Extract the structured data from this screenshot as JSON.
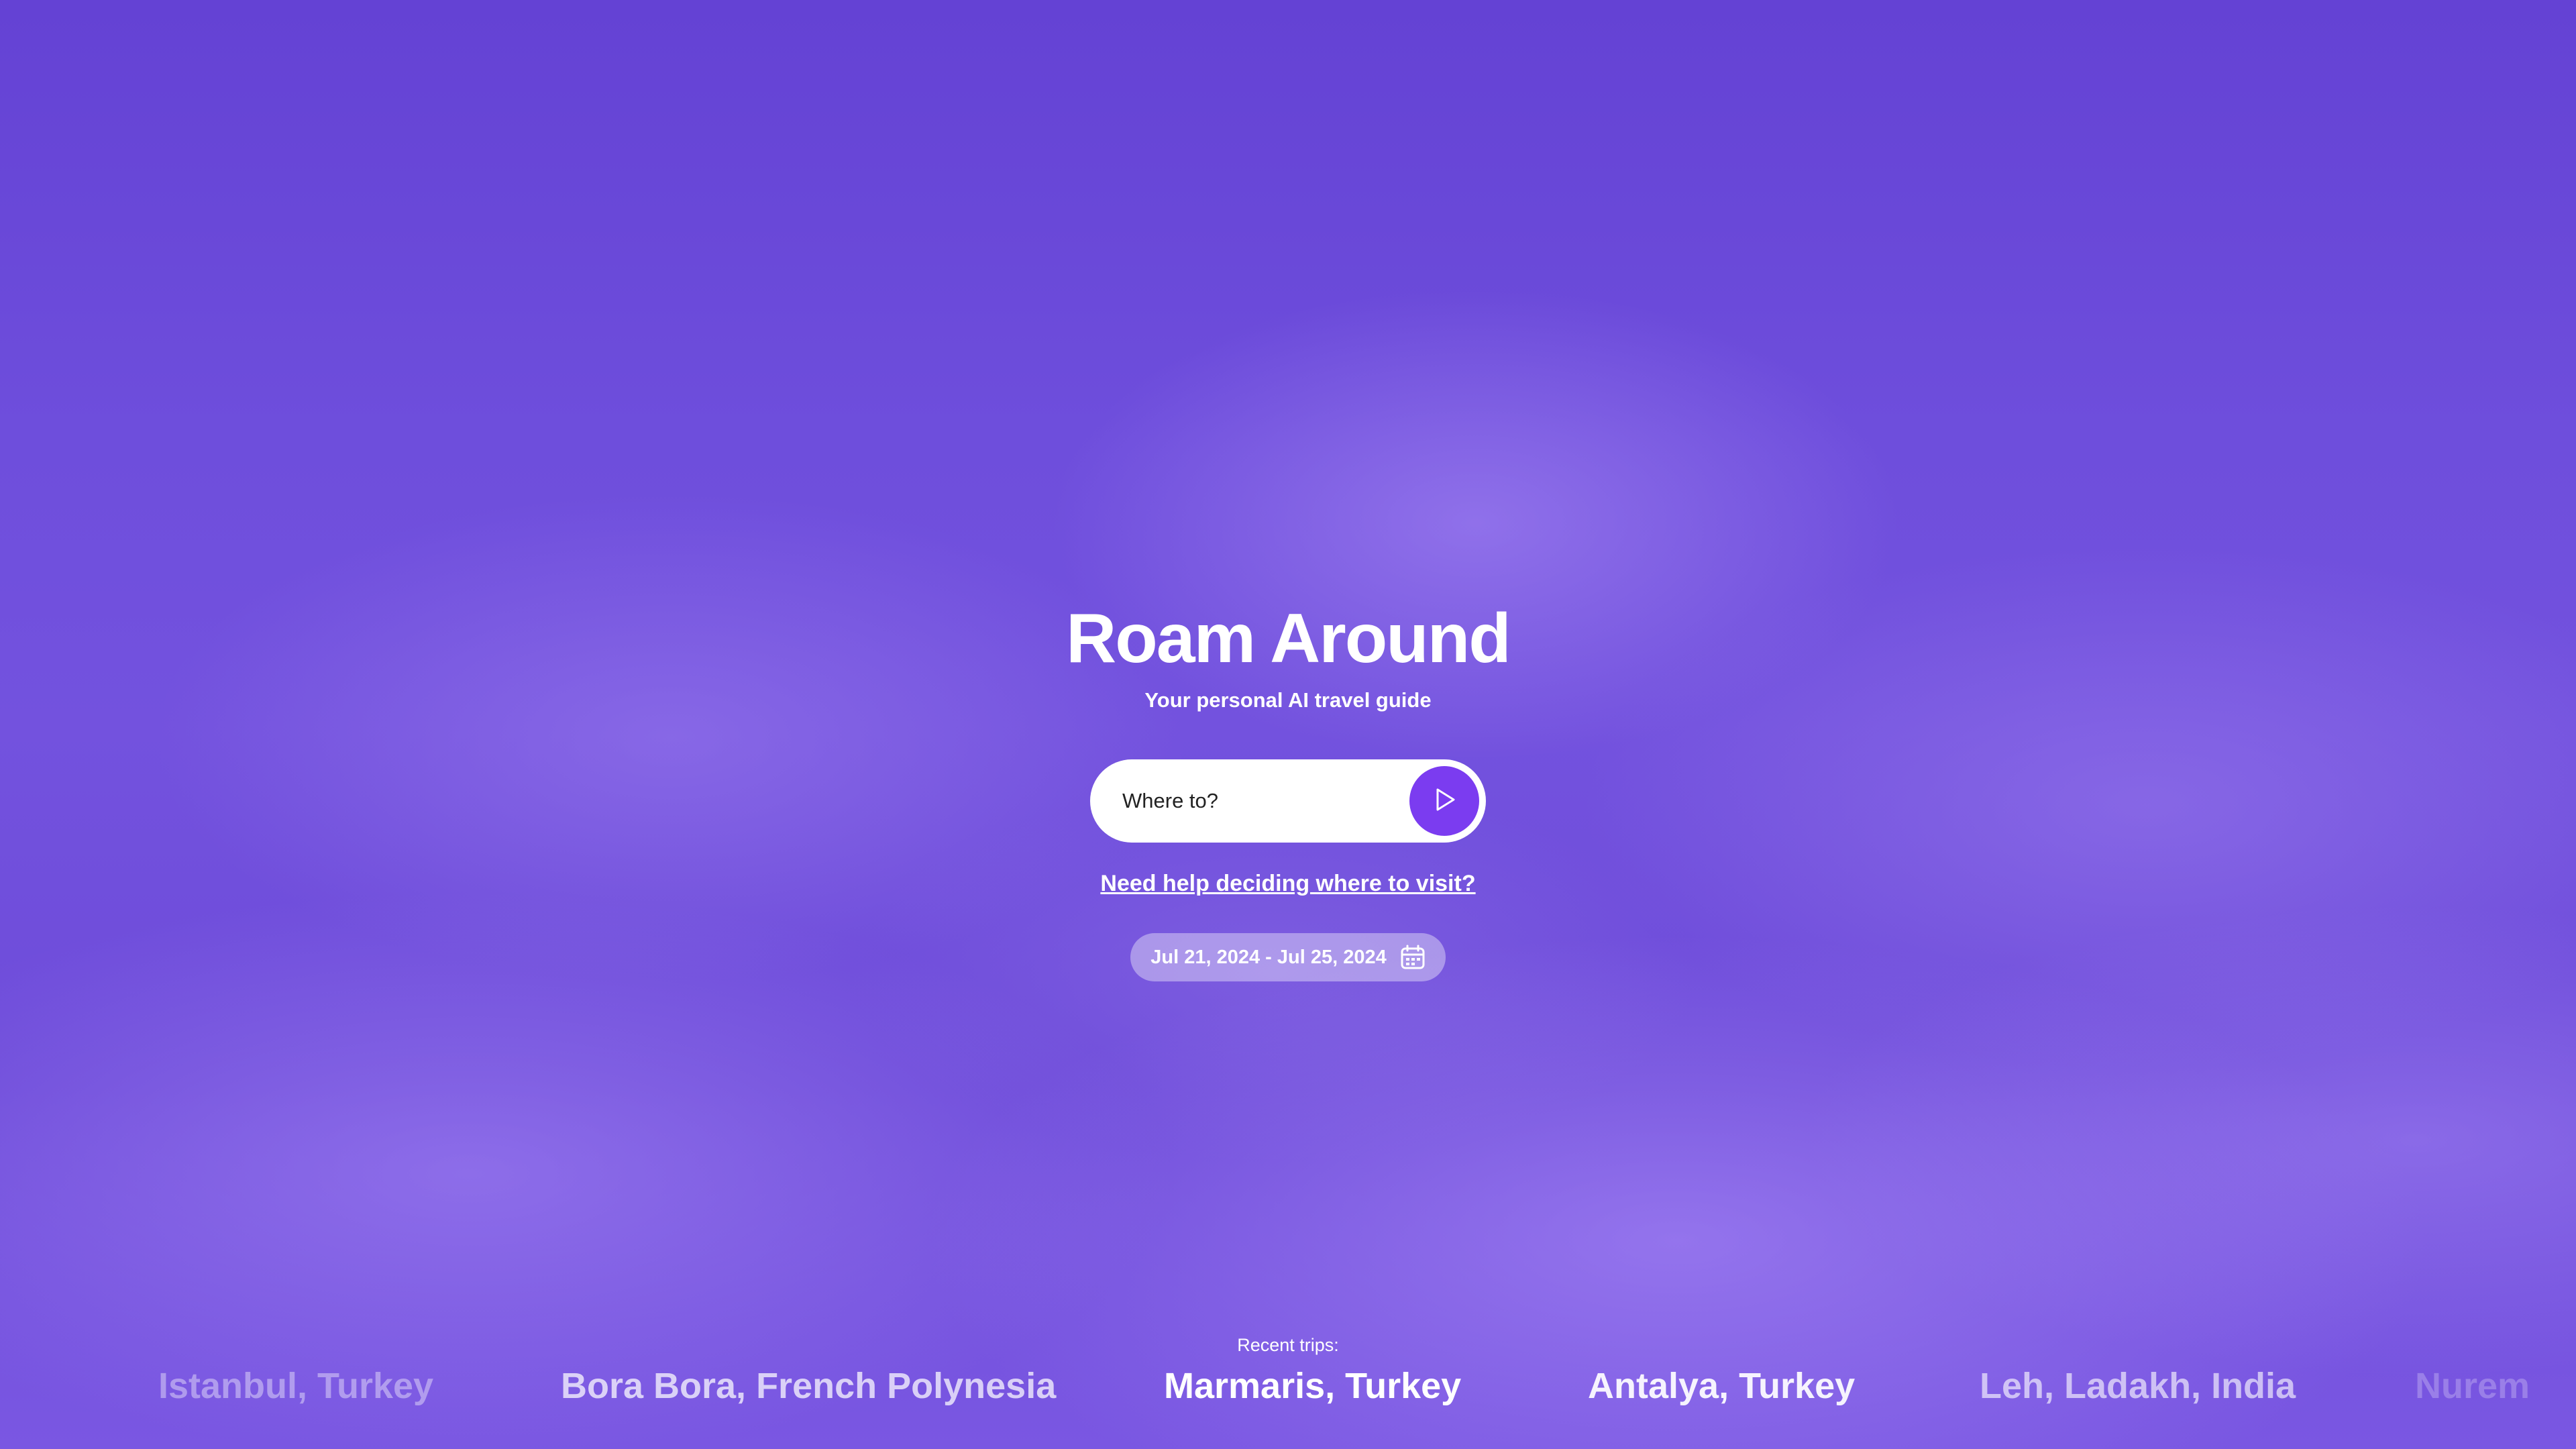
{
  "app": {
    "title": "Roam Around",
    "subtitle": "Your personal AI travel guide"
  },
  "search": {
    "placeholder": "Where to?",
    "value": "",
    "submit_icon": "play-arrow-icon"
  },
  "help_link": "Need help deciding where to visit?",
  "date_range": {
    "label": "Jul 21, 2024 - Jul 25, 2024",
    "icon": "calendar-icon"
  },
  "recent": {
    "label": "Recent trips:",
    "trips": [
      "Istanbul, Turkey",
      "Bora Bora, French Polynesia",
      "Marmaris, Turkey",
      "Antalya, Turkey",
      "Leh, Ladakh, India",
      "Nurem"
    ]
  },
  "colors": {
    "background": "#6a48d8",
    "accent_button": "#7b3cf0",
    "text": "#ffffff"
  }
}
